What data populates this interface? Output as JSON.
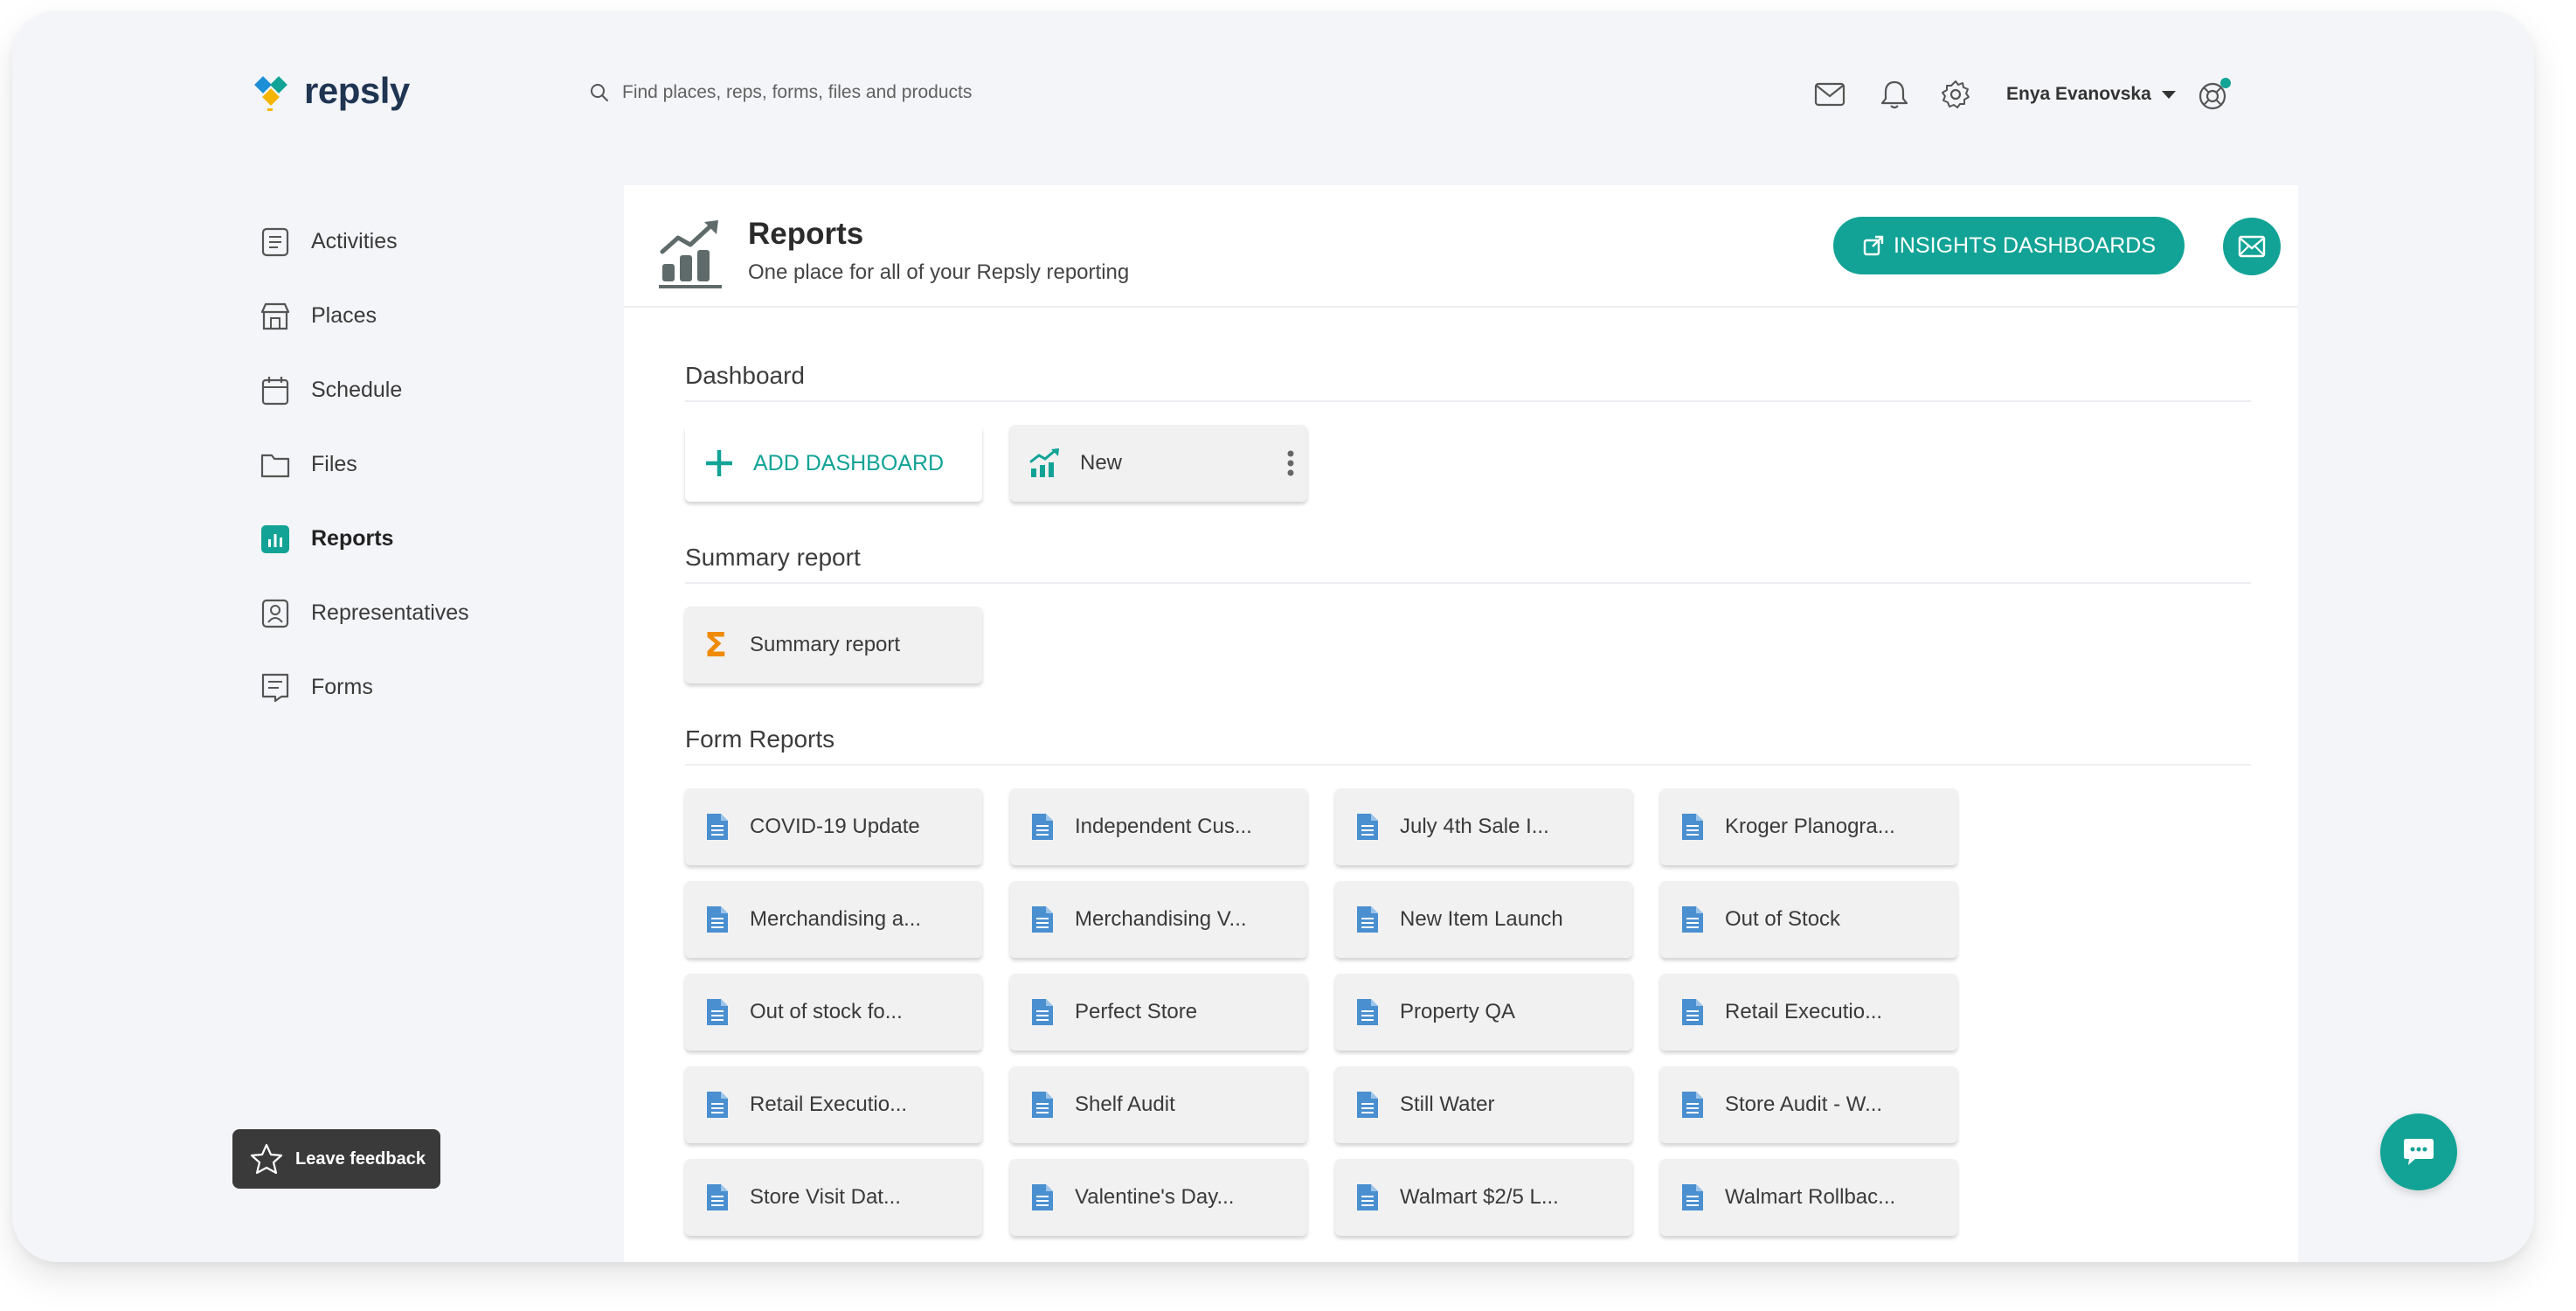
{
  "app": {
    "name": "repsly"
  },
  "search": {
    "placeholder": "Find places, reps, forms, files and products"
  },
  "user": {
    "name": "Enya Evanovska"
  },
  "sidebar": {
    "items": [
      {
        "label": "Activities",
        "icon": "clipboard-icon"
      },
      {
        "label": "Places",
        "icon": "store-icon"
      },
      {
        "label": "Schedule",
        "icon": "calendar-icon"
      },
      {
        "label": "Files",
        "icon": "folder-icon"
      },
      {
        "label": "Reports",
        "icon": "bar-chart-icon",
        "active": true
      },
      {
        "label": "Representatives",
        "icon": "person-badge-icon"
      },
      {
        "label": "Forms",
        "icon": "form-icon"
      }
    ],
    "feedback_label": "Leave feedback"
  },
  "page": {
    "title": "Reports",
    "subtitle": "One place for all of your Repsly reporting",
    "insights_button": "INSIGHTS DASHBOARDS"
  },
  "dashboard": {
    "section_title": "Dashboard",
    "add_label": "ADD DASHBOARD",
    "items": [
      "New"
    ]
  },
  "summary": {
    "section_title": "Summary report",
    "items": [
      "Summary report"
    ]
  },
  "form_reports": {
    "section_title": "Form Reports",
    "items": [
      "COVID-19 Update",
      "Independent Cus...",
      "July 4th Sale I...",
      "Kroger Planogra...",
      "Merchandising a...",
      "Merchandising V...",
      "New Item Launch",
      "Out of Stock",
      "Out of stock fo...",
      "Perfect Store",
      "Property QA",
      "Retail Executio...",
      "Retail Executio...",
      "Shelf Audit",
      "Still Water",
      "Store Audit - W...",
      "Store Visit Dat...",
      "Valentine's Day...",
      "Walmart $2/5 L...",
      "Walmart Rollbac..."
    ]
  },
  "colors": {
    "accent": "#12a396",
    "doc_icon": "#4a8fd0",
    "sigma": "#f08a00",
    "background": "#f4f5f9"
  }
}
